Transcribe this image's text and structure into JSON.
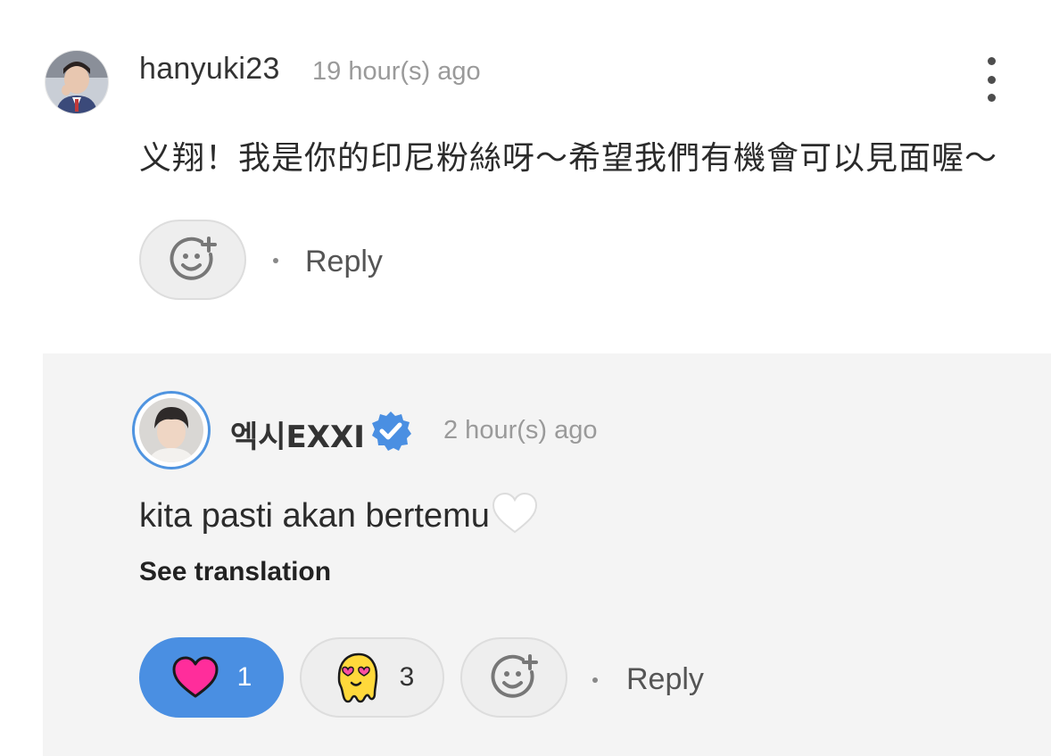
{
  "top_comment": {
    "username": "hanyuki23",
    "time": "19 hour(s) ago",
    "text": "义翔！我是你的印尼粉絲呀～希望我們有機會可以見面喔～",
    "reply_label": "Reply",
    "avatar_icon": "user-avatar",
    "menu_icon": "more-vertical-icon",
    "add_reaction_icon": "add-reaction-icon"
  },
  "reply_comment": {
    "username": "엑시EXXI",
    "verified_icon": "verified-badge-icon",
    "time": "2 hour(s) ago",
    "text": "kita pasti akan bertemu",
    "text_emoji": "white-heart-icon",
    "see_translation": "See translation",
    "reactions": [
      {
        "icon": "heart-icon",
        "count": "1",
        "active": true
      },
      {
        "icon": "heart-eyes-blob-icon",
        "count": "3",
        "active": false
      }
    ],
    "reply_label": "Reply"
  },
  "colors": {
    "accent": "#4a8fe2",
    "reply_background": "#f4f4f4",
    "heart": "#ff2d9b",
    "blob": "#ffd93b"
  }
}
